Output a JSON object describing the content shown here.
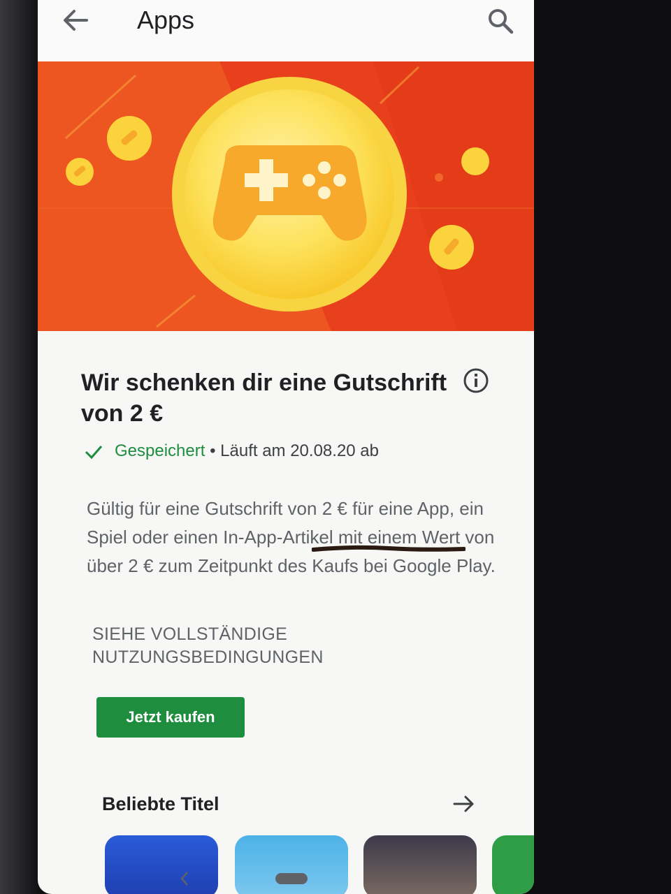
{
  "header": {
    "title": "Apps",
    "back_icon": "arrow-left-icon",
    "search_icon": "search-icon"
  },
  "banner": {
    "illustration": "gamepad-coin-icon",
    "colors": {
      "background": "#e8401c",
      "coin": "#fbd33c"
    }
  },
  "offer": {
    "headline": "Wir schenken dir eine Gutschrift von 2 €",
    "info_icon": "info-icon",
    "status_saved": "Gespeichert",
    "status_separator": "•",
    "status_expiry": "Läuft am 20.08.20 ab",
    "description": "Gültig für eine Gutschrift von 2 € für eine App, ein Spiel oder einen In-App-Artikel mit einem Wert von über 2 € zum Zeitpunkt des Kaufs bei Google Play.",
    "terms_link": "SIEHE VOLLSTÄNDIGE NUTZUNGSBEDINGUNGEN",
    "buy_button": "Jetzt kaufen"
  },
  "popular": {
    "title": "Beliebte Titel",
    "arrow_icon": "arrow-right-icon"
  },
  "colors": {
    "accent_green": "#1e8e3e",
    "text_primary": "#202124",
    "text_secondary": "#5f6368"
  }
}
